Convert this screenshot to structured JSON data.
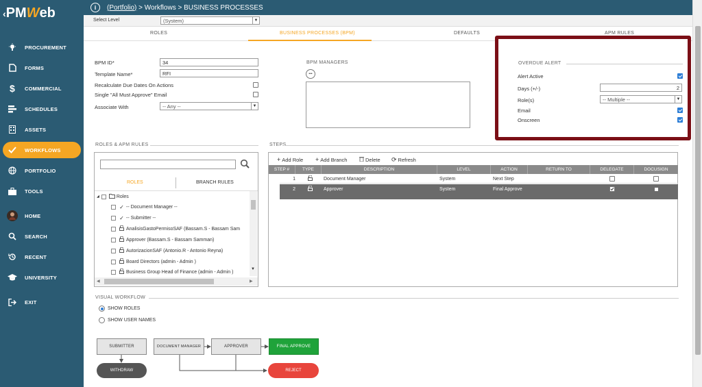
{
  "sidebar": {
    "logo_left": "PM",
    "logo_w": "W",
    "logo_right": "eb",
    "items": [
      {
        "label": "PROCUREMENT",
        "icon": "lightbulb-icon"
      },
      {
        "label": "FORMS",
        "icon": "document-icon"
      },
      {
        "label": "COMMERCIAL",
        "icon": "dollar-icon"
      },
      {
        "label": "SCHEDULES",
        "icon": "schedule-icon"
      },
      {
        "label": "ASSETS",
        "icon": "building-icon"
      },
      {
        "label": "WORKFLOWS",
        "icon": "check-icon"
      },
      {
        "label": "PORTFOLIO",
        "icon": "globe-icon"
      },
      {
        "label": "TOOLS",
        "icon": "toolbox-icon"
      },
      {
        "label": "HOME",
        "icon": "avatar-icon"
      },
      {
        "label": "SEARCH",
        "icon": "search-icon"
      },
      {
        "label": "RECENT",
        "icon": "history-icon"
      },
      {
        "label": "UNIVERSITY",
        "icon": "graduation-icon"
      },
      {
        "label": "EXIT",
        "icon": "exit-icon"
      }
    ]
  },
  "header": {
    "breadcrumb_link": "(Portfolio)",
    "breadcrumb_rest": " > Workflows > BUSINESS PROCESSES"
  },
  "level": {
    "label": "Select Level",
    "value": "(System)"
  },
  "tabs": [
    "ROLES",
    "BUSINESS PROCESSES (BPM)",
    "DEFAULTS",
    "APM RULES"
  ],
  "form": {
    "bpm_id_label": "BPM ID*",
    "bpm_id_value": "34",
    "template_label": "Template Name*",
    "template_value": "RFI",
    "recalc_label": "Recalculate Due Dates On Actions",
    "single_label": "Single \"All Must Approve\" Email",
    "associate_label": "Associate With",
    "associate_value": "-- Any --"
  },
  "bpm_managers": {
    "title": "BPM MANAGERS",
    "more": "•••"
  },
  "overdue": {
    "title": "OVERDUE ALERT",
    "alert_active_label": "Alert Active",
    "days_label": "Days (+/-)",
    "days_value": "2",
    "roles_label": "Role(s)",
    "roles_value": "-- Multiple --",
    "email_label": "Email",
    "onscreen_label": "Onscreen"
  },
  "roles_rules": {
    "title": "ROLES & APM RULES",
    "tab_roles": "ROLES",
    "tab_branch": "BRANCH RULES",
    "root": "Roles",
    "items": [
      {
        "label": "-- Document Manager --",
        "icon": "check"
      },
      {
        "label": "-- Submitter --",
        "icon": "check"
      },
      {
        "label": "AnalisisGastoPermisoSAF (Bassam.S - Bassam Sam",
        "icon": "lock"
      },
      {
        "label": "Approver (Bassam.S - Bassam Samman)",
        "icon": "lock"
      },
      {
        "label": "AutorizacionSAF (Antonio.R - Antonio Reyna)",
        "icon": "lock"
      },
      {
        "label": "Board Directors (admin - Admin )",
        "icon": "lock"
      },
      {
        "label": "Business Group Head of Finance (admin - Admin )",
        "icon": "lock"
      }
    ]
  },
  "steps": {
    "title": "STEPS",
    "toolbar": {
      "add_role": "Add Role",
      "add_branch": "Add Branch",
      "delete": "Delete",
      "refresh": "Refresh"
    },
    "columns": [
      "STEP #",
      "TYPE",
      "DESCRIPTION",
      "LEVEL",
      "ACTION",
      "RETURN TO",
      "DELEGATE",
      "DOCUSIGN"
    ],
    "rows": [
      {
        "step": "1",
        "description": "Document Manager",
        "level": "System",
        "action": "Next Step",
        "return_to": ""
      },
      {
        "step": "2",
        "description": "Approver",
        "level": "System",
        "action": "Final Approve",
        "return_to": ""
      }
    ]
  },
  "visual": {
    "title": "VISUAL WORKFLOW",
    "show_roles": "SHOW ROLES",
    "show_users": "SHOW USER NAMES",
    "nodes": {
      "submitter": "SUBMITTER",
      "withdraw": "WITHDRAW",
      "doc_manager": "DOCUMENT MANAGER",
      "approver": "APPROVER",
      "final": "FINAL APPROVE",
      "reject": "REJECT"
    }
  },
  "colors": {
    "sidebar": "#2b5b73",
    "accent": "#f5a623",
    "highlight_border": "#7b0f16",
    "final_green": "#1fa33a",
    "reject_red": "#e8453c",
    "withdraw_grey": "#555555"
  }
}
